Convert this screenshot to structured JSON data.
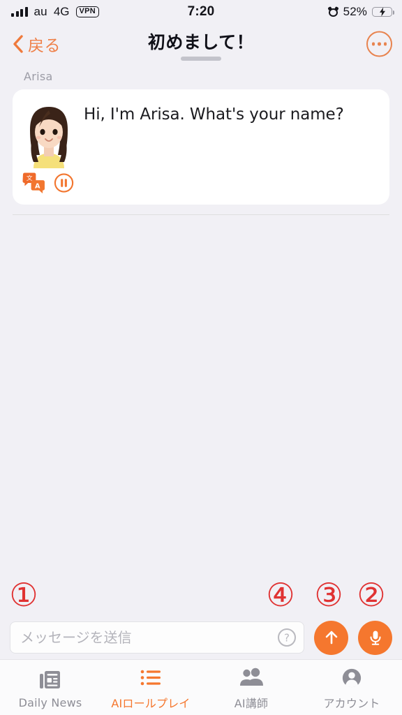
{
  "statusbar": {
    "carrier": "au",
    "network": "4G",
    "vpn_badge": "VPN",
    "time": "7:20",
    "battery_percent": "52%",
    "battery_level": 52,
    "alarm_icon": "alarm-clock-icon",
    "signal_icon": "cellular-signal-icon",
    "battery_icon": "battery-charging-icon"
  },
  "navbar": {
    "back_label": "戻る",
    "back_icon": "chevron-left-icon",
    "title": "初めまして！",
    "more_icon": "more-options-icon"
  },
  "chat": {
    "messages": [
      {
        "sender": "Arisa",
        "text": "Hi, I'm Arisa. What's your name?",
        "avatar_icon": "avatar-arisa-icon",
        "translate_icon": "translate-icon",
        "pause_icon": "pause-audio-icon"
      }
    ]
  },
  "annotations": [
    {
      "id": "annotation-1",
      "label": "①"
    },
    {
      "id": "annotation-4",
      "label": "④"
    },
    {
      "id": "annotation-3",
      "label": "③"
    },
    {
      "id": "annotation-2",
      "label": "②"
    }
  ],
  "composer": {
    "input_value": "",
    "input_placeholder": "メッセージを送信",
    "help_icon": "help-question-icon",
    "send_icon": "send-arrow-up-icon",
    "mic_icon": "microphone-icon"
  },
  "tabbar": {
    "items": [
      {
        "label": "Daily News",
        "icon": "news-icon",
        "active": false
      },
      {
        "label": "AIロールプレイ",
        "icon": "list-icon",
        "active": true
      },
      {
        "label": "AI講師",
        "icon": "people-icon",
        "active": false
      },
      {
        "label": "アカウント",
        "icon": "account-circle-icon",
        "active": false
      }
    ]
  },
  "colors": {
    "accent": "#f5772e",
    "accent_light": "#e8834e",
    "annotation_red": "#e03232",
    "background": "#f1f0f5",
    "bubble": "#ffffff",
    "tab_inactive": "#8e8e96",
    "battery_green": "#4cd964"
  }
}
